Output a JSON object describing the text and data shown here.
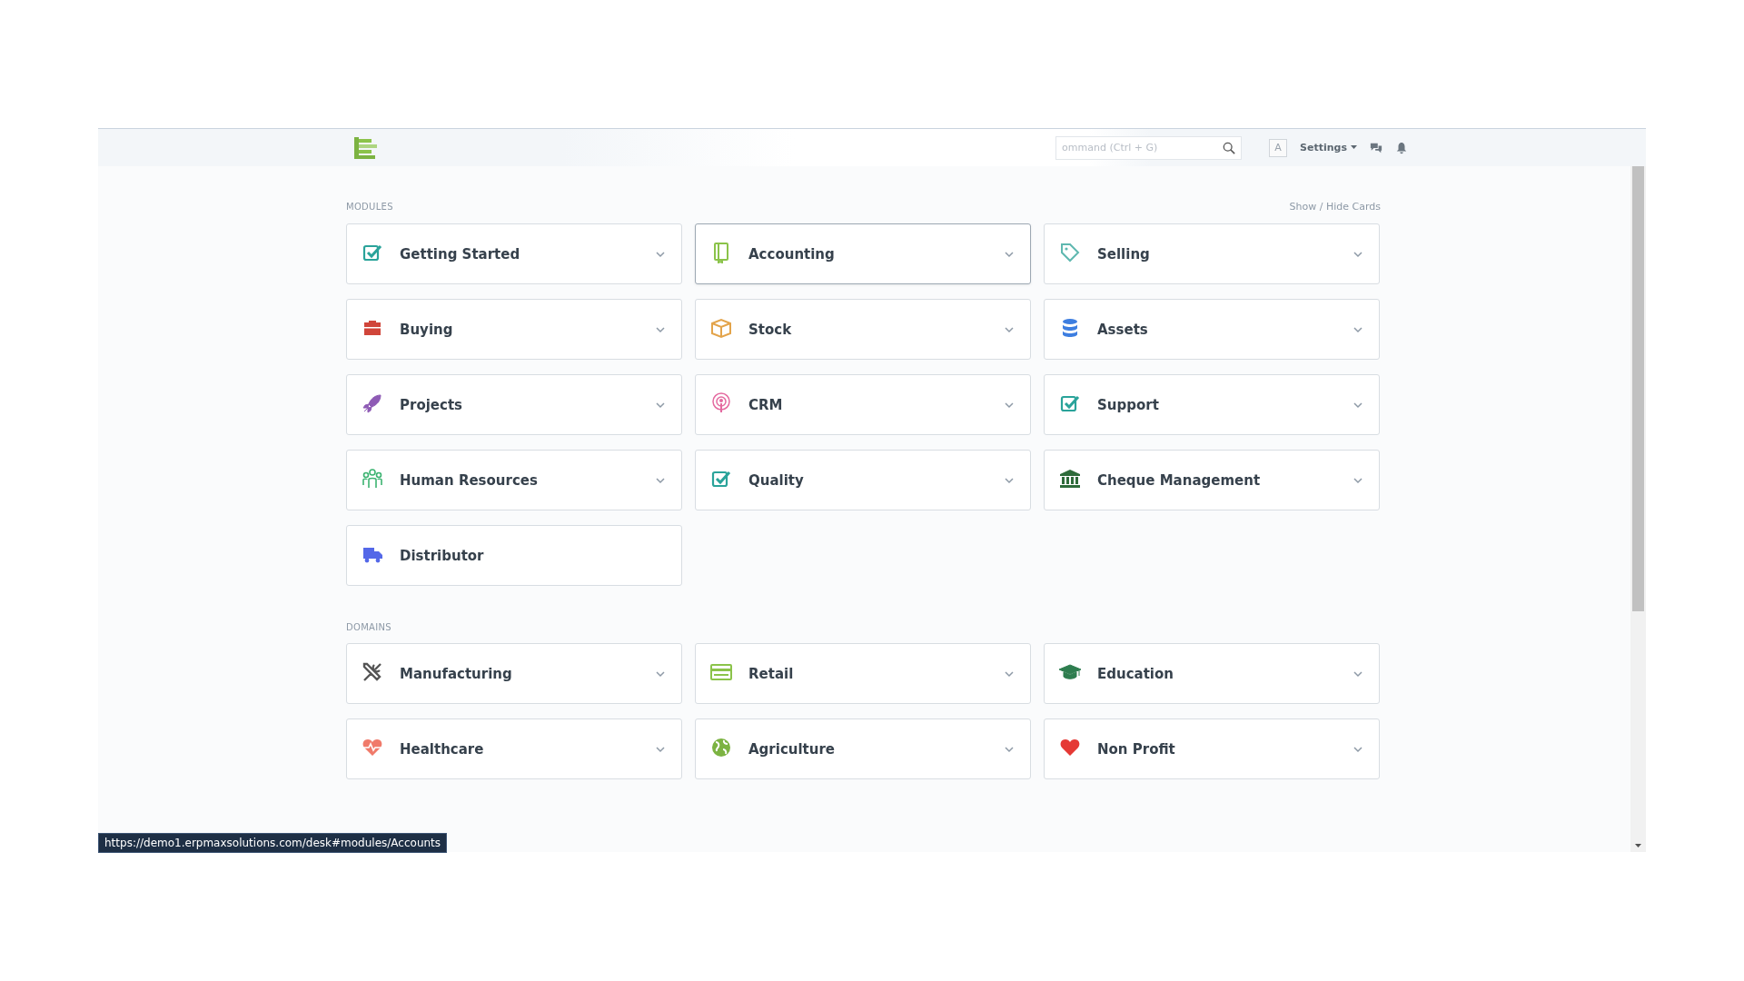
{
  "topbar": {
    "search": {
      "placeholder": "ommand (Ctrl + G)"
    },
    "avatar": "A",
    "settings": "Settings"
  },
  "sections": [
    {
      "title": "MODULES",
      "action": "Show / Hide Cards",
      "cards": [
        {
          "label": "Getting Started",
          "kind": "check",
          "color": "#2aa39a",
          "expandable": true,
          "highlighted": false
        },
        {
          "label": "Accounting",
          "kind": "book",
          "color": "#8bc34a",
          "expandable": true,
          "highlighted": true
        },
        {
          "label": "Selling",
          "kind": "tag",
          "color": "#5fb8b0",
          "expandable": true,
          "highlighted": false
        },
        {
          "label": "Buying",
          "kind": "briefcase",
          "color": "#d0453a",
          "expandable": true,
          "highlighted": false
        },
        {
          "label": "Stock",
          "kind": "box",
          "color": "#e3a44b",
          "expandable": true,
          "highlighted": false
        },
        {
          "label": "Assets",
          "kind": "database",
          "color": "#3d7ee0",
          "expandable": true,
          "highlighted": false
        },
        {
          "label": "Projects",
          "kind": "rocket",
          "color": "#8e5bb5",
          "expandable": true,
          "highlighted": false
        },
        {
          "label": "CRM",
          "kind": "podcast",
          "color": "#e46aa0",
          "expandable": true,
          "highlighted": false
        },
        {
          "label": "Support",
          "kind": "check",
          "color": "#2aa39a",
          "expandable": true,
          "highlighted": false
        },
        {
          "label": "Human Resources",
          "kind": "users",
          "color": "#3cb371",
          "expandable": true,
          "highlighted": false
        },
        {
          "label": "Quality",
          "kind": "check",
          "color": "#2aa39a",
          "expandable": true,
          "highlighted": false
        },
        {
          "label": "Cheque Management",
          "kind": "bank",
          "color": "#2e6b3a",
          "expandable": true,
          "highlighted": false
        },
        {
          "label": "Distributor",
          "kind": "truck",
          "color": "#5468e8",
          "expandable": false,
          "highlighted": false
        }
      ]
    },
    {
      "title": "DOMAINS",
      "cards": [
        {
          "label": "Manufacturing",
          "kind": "tools",
          "color": "#555555",
          "expandable": true,
          "highlighted": false
        },
        {
          "label": "Retail",
          "kind": "card",
          "color": "#8bc34a",
          "expandable": true,
          "highlighted": false
        },
        {
          "label": "Education",
          "kind": "cap",
          "color": "#2e7d4f",
          "expandable": true,
          "highlighted": false
        },
        {
          "label": "Healthcare",
          "kind": "heartbeat",
          "color": "#f07a6a",
          "expandable": true,
          "highlighted": false
        },
        {
          "label": "Agriculture",
          "kind": "globe",
          "color": "#7cb342",
          "expandable": true,
          "highlighted": false
        },
        {
          "label": "Non Profit",
          "kind": "heart",
          "color": "#e53935",
          "expandable": true,
          "highlighted": false
        }
      ]
    }
  ],
  "status_bar": "https://demo1.erpmaxsolutions.com/desk#modules/Accounts"
}
